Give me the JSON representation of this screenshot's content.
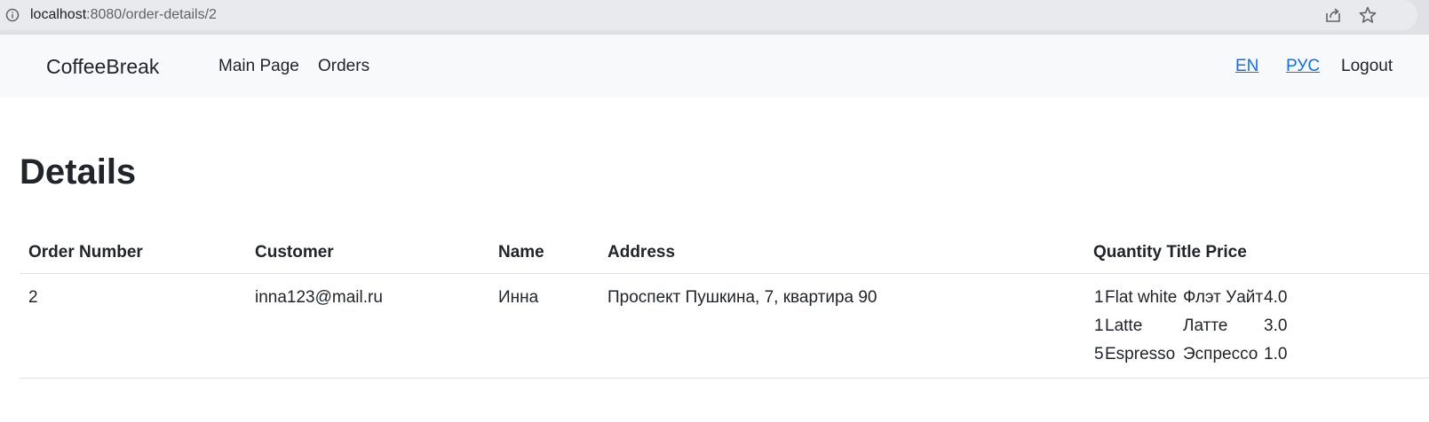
{
  "browser": {
    "url_host": "localhost",
    "url_path": ":8080/order-details/2"
  },
  "navbar": {
    "brand": "CoffeeBreak",
    "links": [
      "Main Page",
      "Orders"
    ],
    "lang_en": "EN",
    "lang_ru": "РУС",
    "logout": "Logout"
  },
  "page": {
    "title": "Details"
  },
  "table": {
    "headers": {
      "order_number": "Order Number",
      "customer": "Customer",
      "name": "Name",
      "address": "Address",
      "items": "Quantity Title Price"
    },
    "row": {
      "order_number": "2",
      "customer": "inna123@mail.ru",
      "name": "Инна",
      "address": "Проспект Пушкина, 7, квартира 90",
      "items": [
        {
          "quantity": "1",
          "title_en": "Flat white",
          "title_ru": "Флэт Уайт",
          "price": "4.0"
        },
        {
          "quantity": "1",
          "title_en": "Latte",
          "title_ru": "Латте",
          "price": "3.0"
        },
        {
          "quantity": "5",
          "title_en": "Espresso",
          "title_ru": "Эспрессо",
          "price": "1.0"
        }
      ]
    }
  }
}
